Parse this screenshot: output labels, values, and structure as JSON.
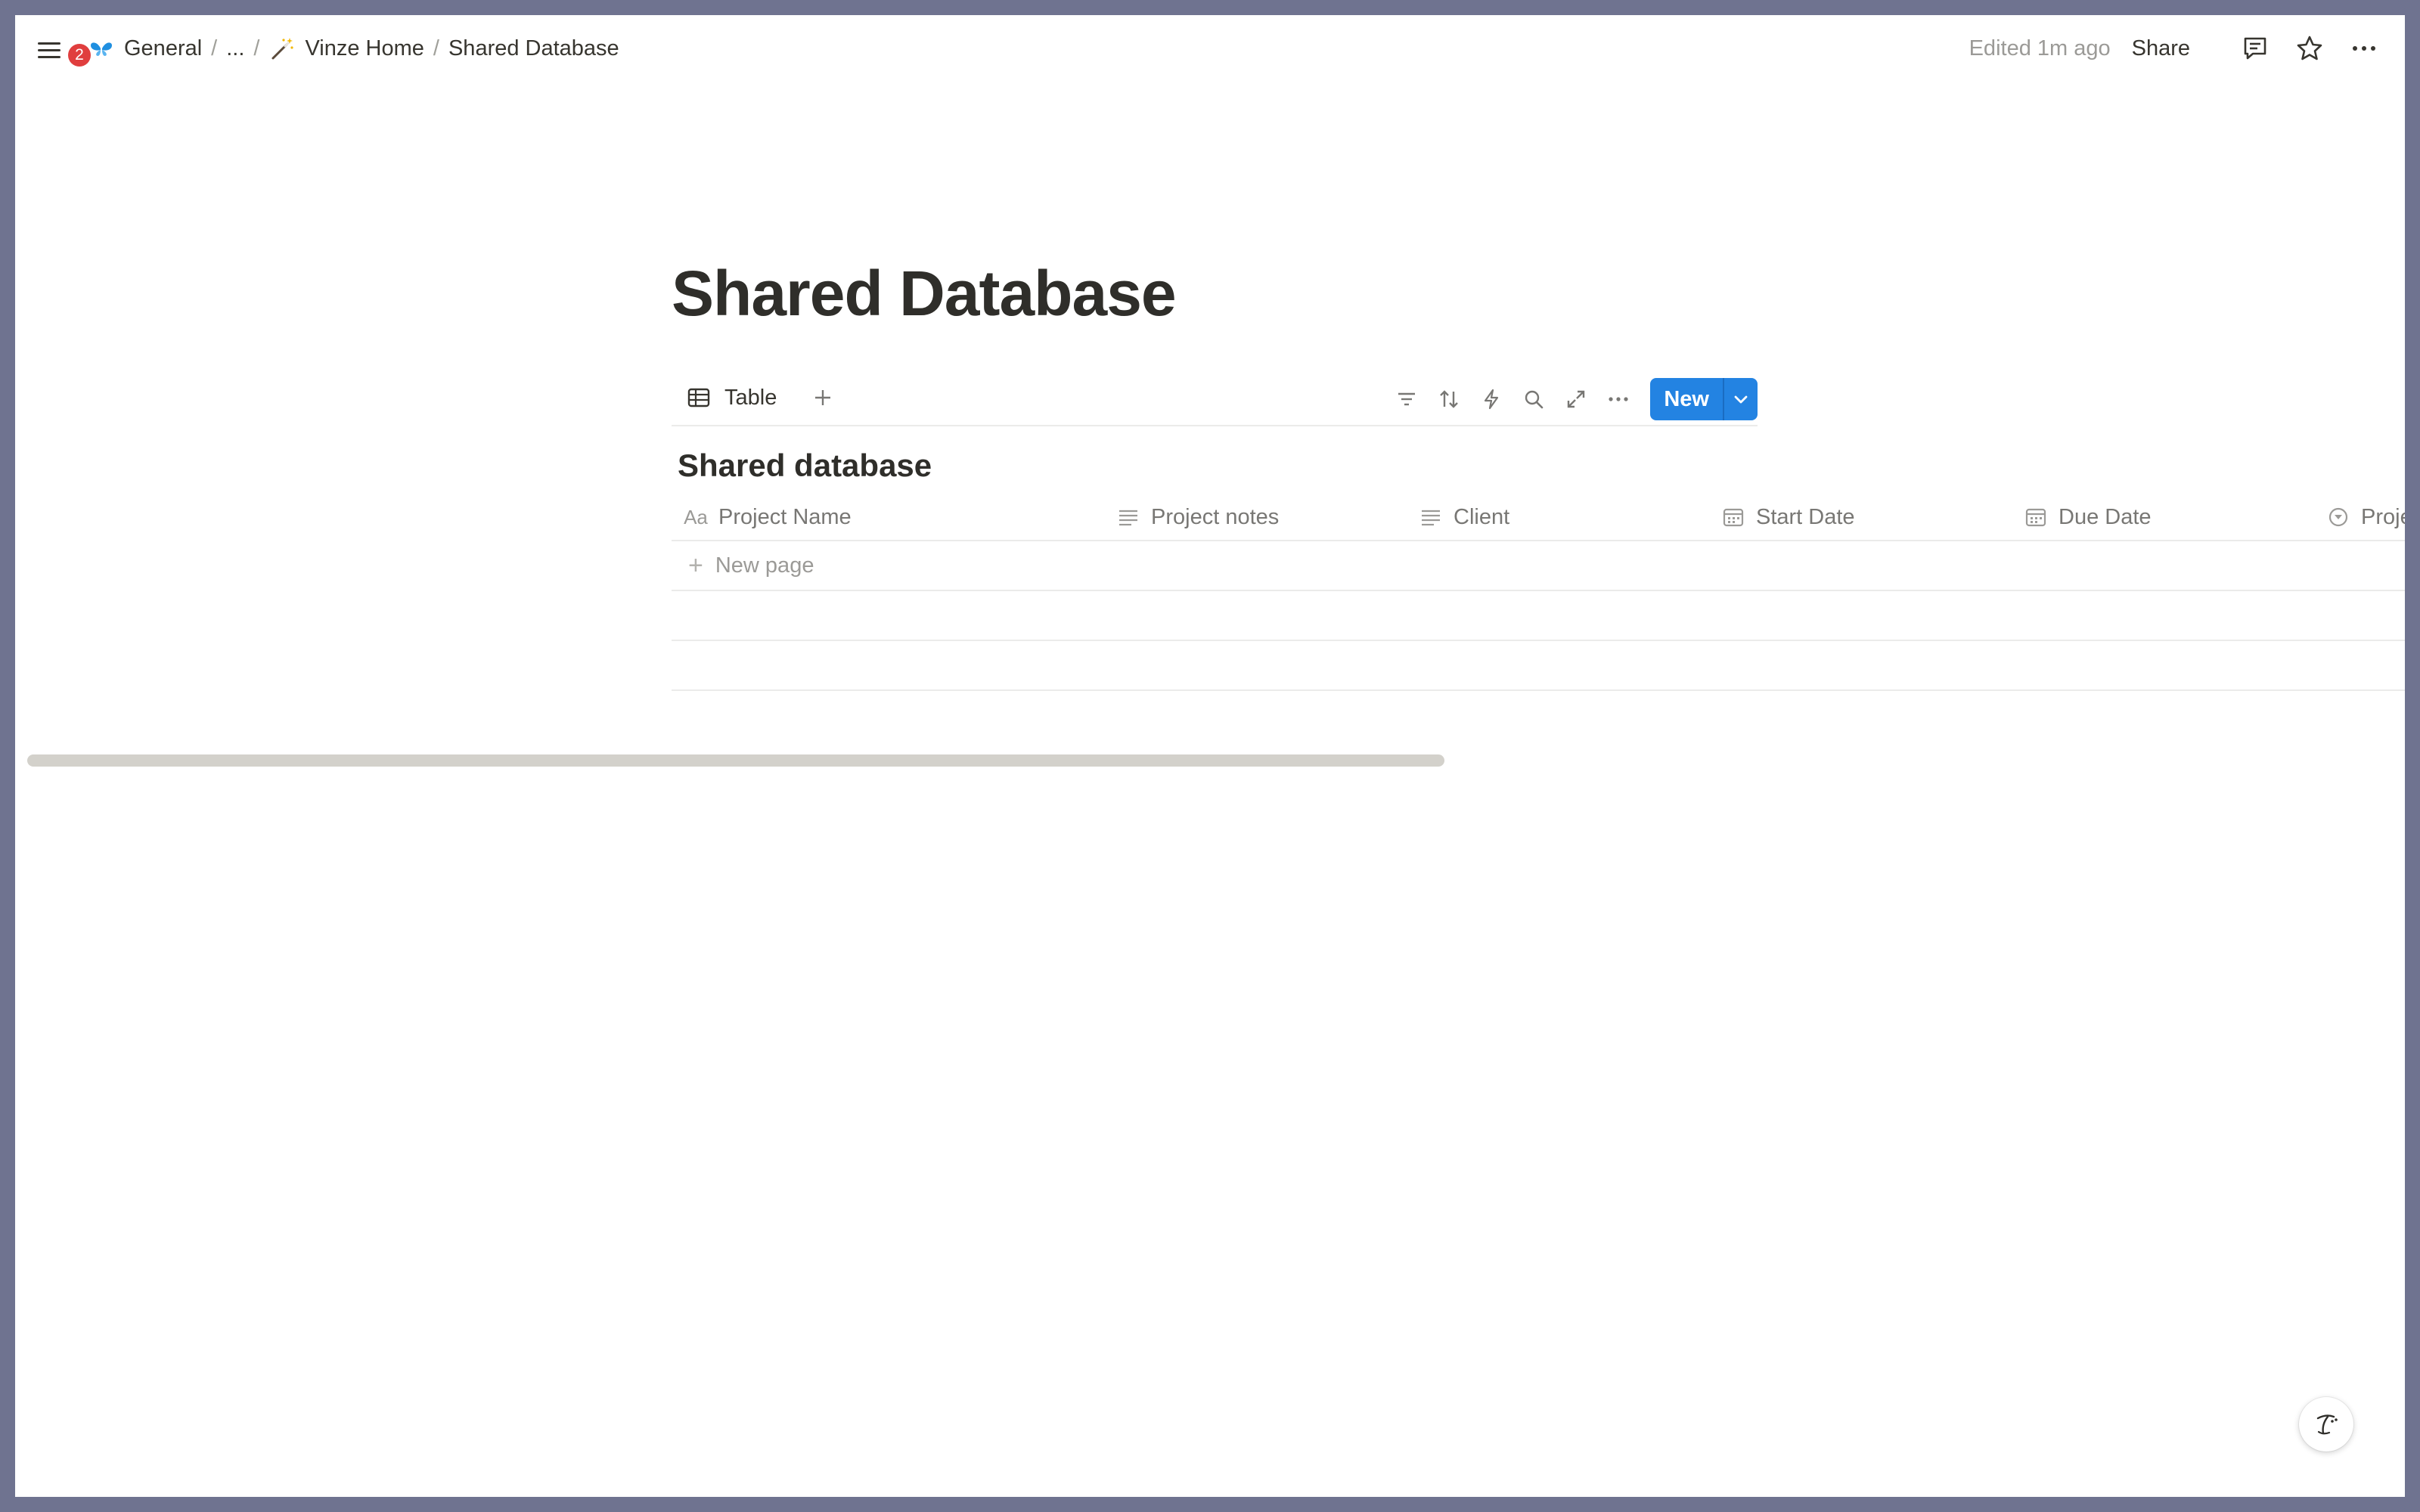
{
  "topbar": {
    "notification_count": "2",
    "breadcrumbs": {
      "workspace": "General",
      "ellipsis": "...",
      "parent": "Vinze Home",
      "current": "Shared Database"
    },
    "edited": "Edited 1m ago",
    "share": "Share"
  },
  "page": {
    "title": "Shared Database"
  },
  "view_bar": {
    "tab_label": "Table",
    "new_button": "New"
  },
  "database": {
    "title": "Shared database",
    "columns": [
      {
        "label": "Project Name",
        "icon": "Aa"
      },
      {
        "label": "Project notes",
        "icon": "text-lines-icon"
      },
      {
        "label": "Client",
        "icon": "text-lines-icon"
      },
      {
        "label": "Start Date",
        "icon": "calendar-icon"
      },
      {
        "label": "Due Date",
        "icon": "calendar-icon"
      },
      {
        "label": "Proje",
        "icon": "status-icon"
      }
    ],
    "new_page": "New page"
  },
  "colors": {
    "accent": "#2383e2",
    "badge": "#e03e3e",
    "text": "#37352f",
    "muted": "#9b9a97"
  }
}
